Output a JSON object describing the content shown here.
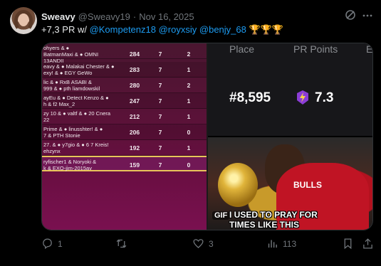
{
  "tweet": {
    "author_name": "Sweavy",
    "author_handle": "@Sweavy19",
    "separator": "·",
    "date": "Nov 16, 2025",
    "text_prefix": "+7,3 PR w/ ",
    "mentions": [
      "@Kompetenz18",
      "@royxsiy",
      "@benjy_68"
    ],
    "trophies": "🏆🏆🏆"
  },
  "leaderboard": {
    "rows": [
      {
        "names": "ohyers & ●",
        "names2": "BatmanMaxi & ● OMNI",
        "names3": "13ANDII",
        "c1": "284",
        "c2": "7",
        "c3": "2"
      },
      {
        "names": "eavy & ● Malakai Chester & ●",
        "names2": "exy! & ● EGY GeWo",
        "names3": "",
        "c1": "283",
        "c2": "7",
        "c3": "1"
      },
      {
        "names": "lic & ● RxB ASABI &",
        "names2": "999 & ● pth liamdowskil",
        "names3": "",
        "c1": "280",
        "c2": "7",
        "c3": "2"
      },
      {
        "names": "ayEu & ● Detect Kenzo & ●",
        "names2": "h & f2 Max_2",
        "names3": "",
        "c1": "247",
        "c2": "7",
        "c3": "1"
      },
      {
        "names": "zy 10 & ● valtf & ● 20 Cnera",
        "names2": "22",
        "names3": "",
        "c1": "212",
        "c2": "7",
        "c3": "1"
      },
      {
        "names": "Prime & ● linusshter! & ●",
        "names2": "7 & PTH Stonie",
        "names3": "",
        "c1": "206",
        "c2": "7",
        "c3": "0"
      },
      {
        "names": "27. & ● y7gio & ● 6 7 Kreis!",
        "names2": "ehzynx",
        "names3": "",
        "c1": "192",
        "c2": "7",
        "c3": "1"
      },
      {
        "names": "ryfischer1 & Noryoki &",
        "names2": "k & EXO-jim-2015av",
        "names3": "",
        "c1": "159",
        "c2": "7",
        "c3": "0"
      }
    ]
  },
  "stats": {
    "header_place": "Place",
    "header_pr": "PR Points",
    "header_e": "E",
    "place": "#8,595",
    "pr_points": "7.3",
    "bolt_color": "#8b3dd6"
  },
  "gif": {
    "badge": "GIF",
    "caption_line1": "I USED TO PRAY FOR",
    "caption_line2": "TIMES LIKE THIS",
    "jersey_text": "BULLS"
  },
  "actions": {
    "reply_count": "1",
    "retweet_count": "",
    "like_count": "3",
    "view_count": "113"
  }
}
